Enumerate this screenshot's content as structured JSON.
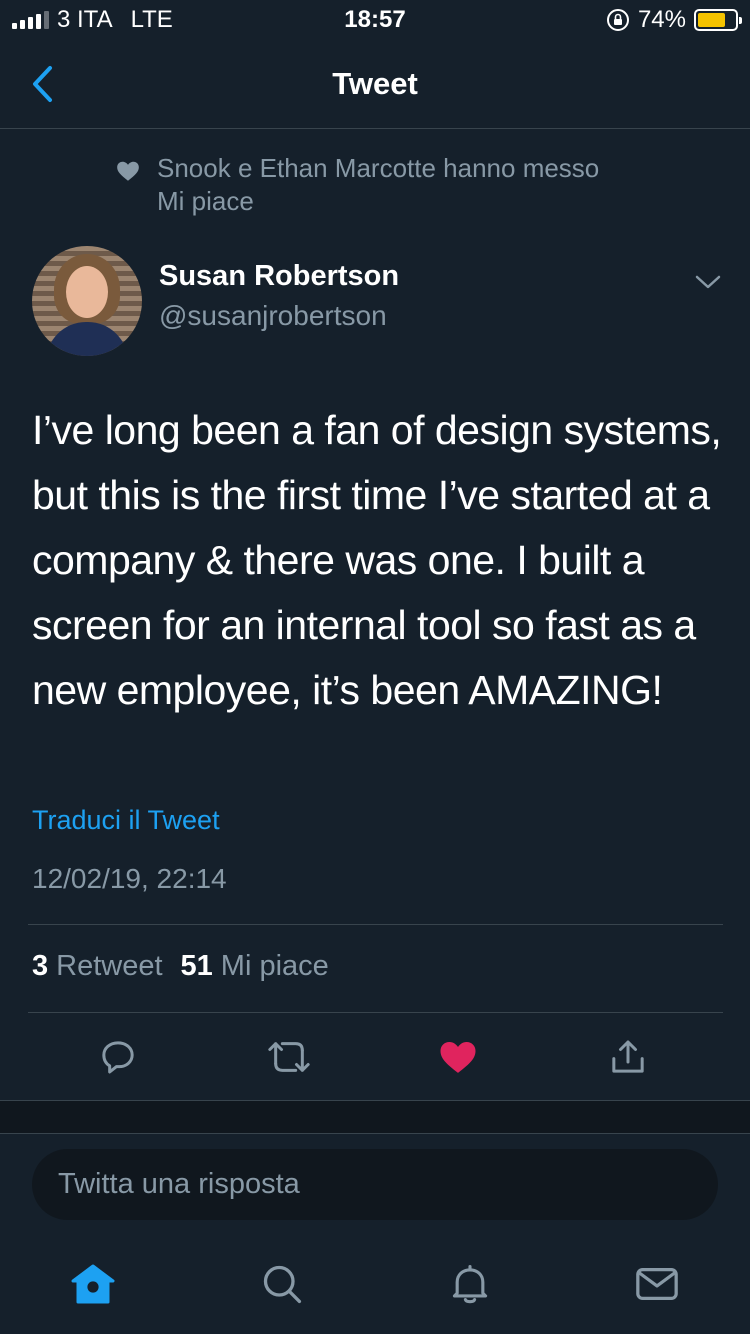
{
  "status_bar": {
    "carrier": "3 ITA",
    "network": "LTE",
    "time": "18:57",
    "battery_percent": "74%",
    "battery_level": 0.74,
    "battery_color": "#f5c300"
  },
  "header": {
    "title": "Tweet",
    "back_icon": "chevron-left-icon"
  },
  "social_context": {
    "icon": "heart-icon",
    "line1": "Snook e Ethan Marcotte hanno messo",
    "line2": "Mi piace"
  },
  "author": {
    "name": "Susan Robertson",
    "handle": "@susanjrobertson"
  },
  "tweet": {
    "text": "I’ve long been a fan of design systems, but this is the first time I’ve started at a company & there was one. I built a screen for an internal tool so fast as a new employee, it’s been AMAZING!",
    "translate_label": "Traduci il Tweet",
    "timestamp": "12/02/19, 22:14"
  },
  "stats": {
    "retweets_count": "3",
    "retweets_label": "Retweet",
    "likes_count": "51",
    "likes_label": "Mi piace"
  },
  "actions": {
    "reply_icon": "reply-icon",
    "retweet_icon": "retweet-icon",
    "like_icon": "heart-icon",
    "liked": true,
    "like_color": "#e0245e",
    "share_icon": "share-icon"
  },
  "reply_bar": {
    "placeholder": "Twitta una risposta"
  },
  "tab_bar": {
    "active": "home",
    "accent": "#1da1f2",
    "tabs": [
      "home-icon",
      "search-icon",
      "notifications-icon",
      "messages-icon"
    ]
  }
}
